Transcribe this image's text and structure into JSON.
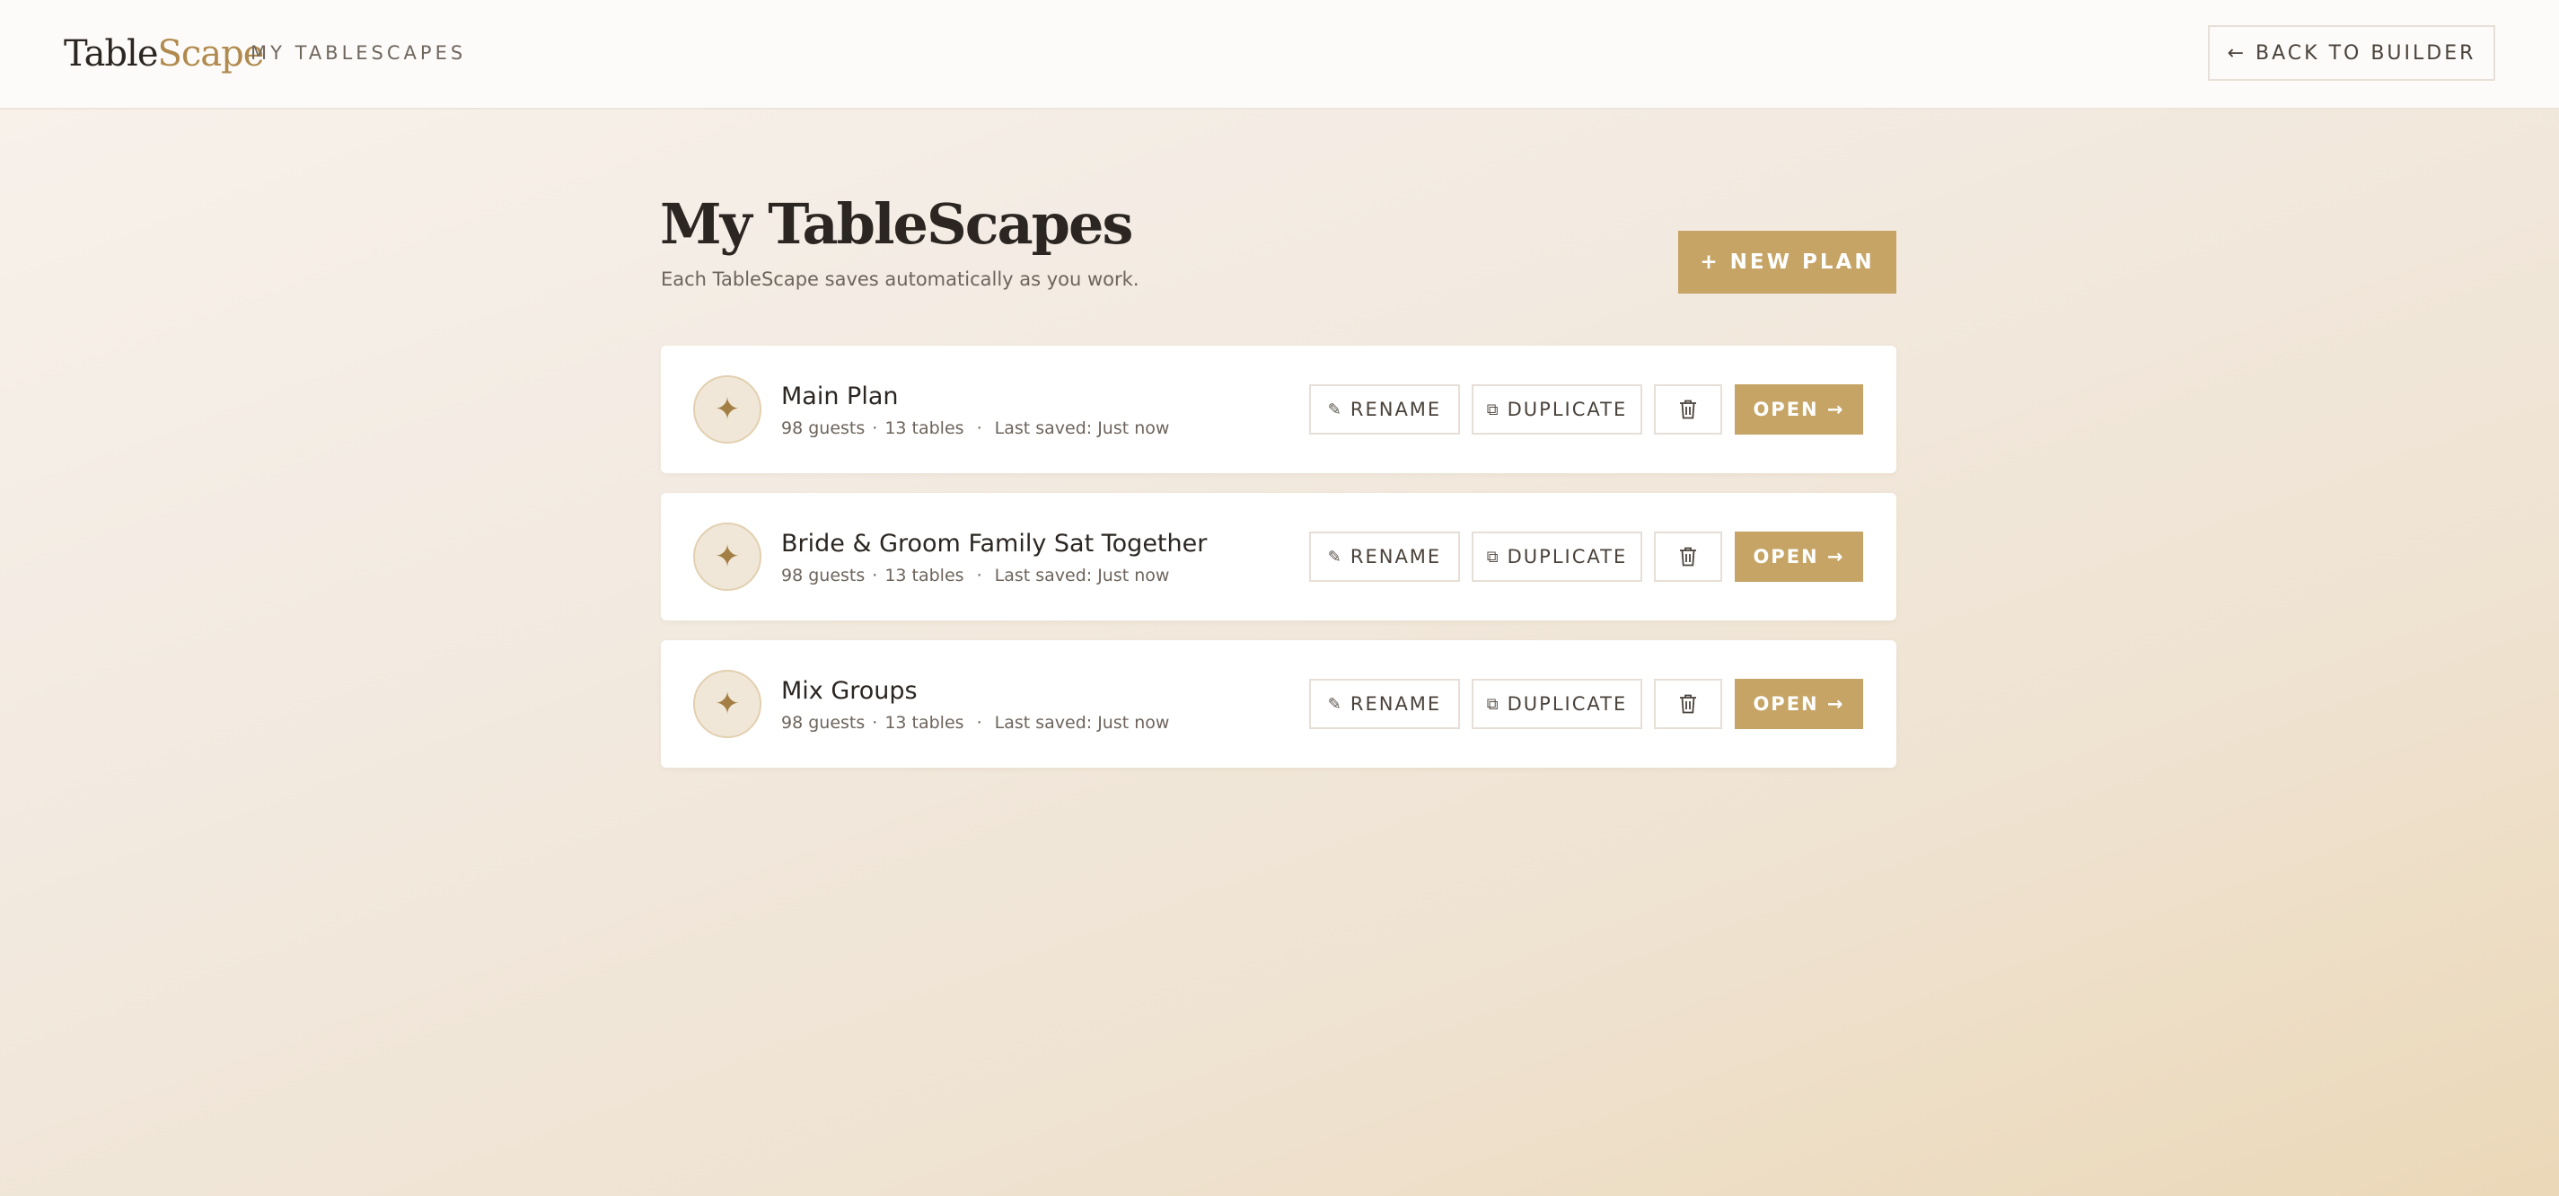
{
  "app": {
    "brand_part1": "Table",
    "brand_part2": "Scape",
    "nav_label": "MY TABLESCAPES",
    "back_button_label": "← BACK TO BUILDER"
  },
  "header": {
    "title": "My TableScapes",
    "subtitle": "Each TableScape saves automatically as you work.",
    "new_plan_label": "+ NEW PLAN"
  },
  "plans": [
    {
      "name": "Main Plan",
      "guests": "98 guests",
      "tables": "13 tables",
      "last_saved": "Last saved: Just now"
    },
    {
      "name": "Bride & Groom Family Sat Together",
      "guests": "98 guests",
      "tables": "13 tables",
      "last_saved": "Last saved: Just now"
    },
    {
      "name": "Mix Groups",
      "guests": "98 guests",
      "tables": "13 tables",
      "last_saved": "Last saved: Just now"
    }
  ],
  "actions": {
    "rename_label": "RENAME",
    "duplicate_label": "DUPLICATE",
    "open_label": "OPEN →",
    "rename_icon": "pencil-icon",
    "duplicate_icon": "copy-icon",
    "delete_icon": "trash-icon",
    "plan_icon": "sparkle-icon"
  },
  "colors": {
    "accent": "#c6a466",
    "brand_accent": "#b08a4e",
    "icon_bg": "#f1e7d8"
  }
}
